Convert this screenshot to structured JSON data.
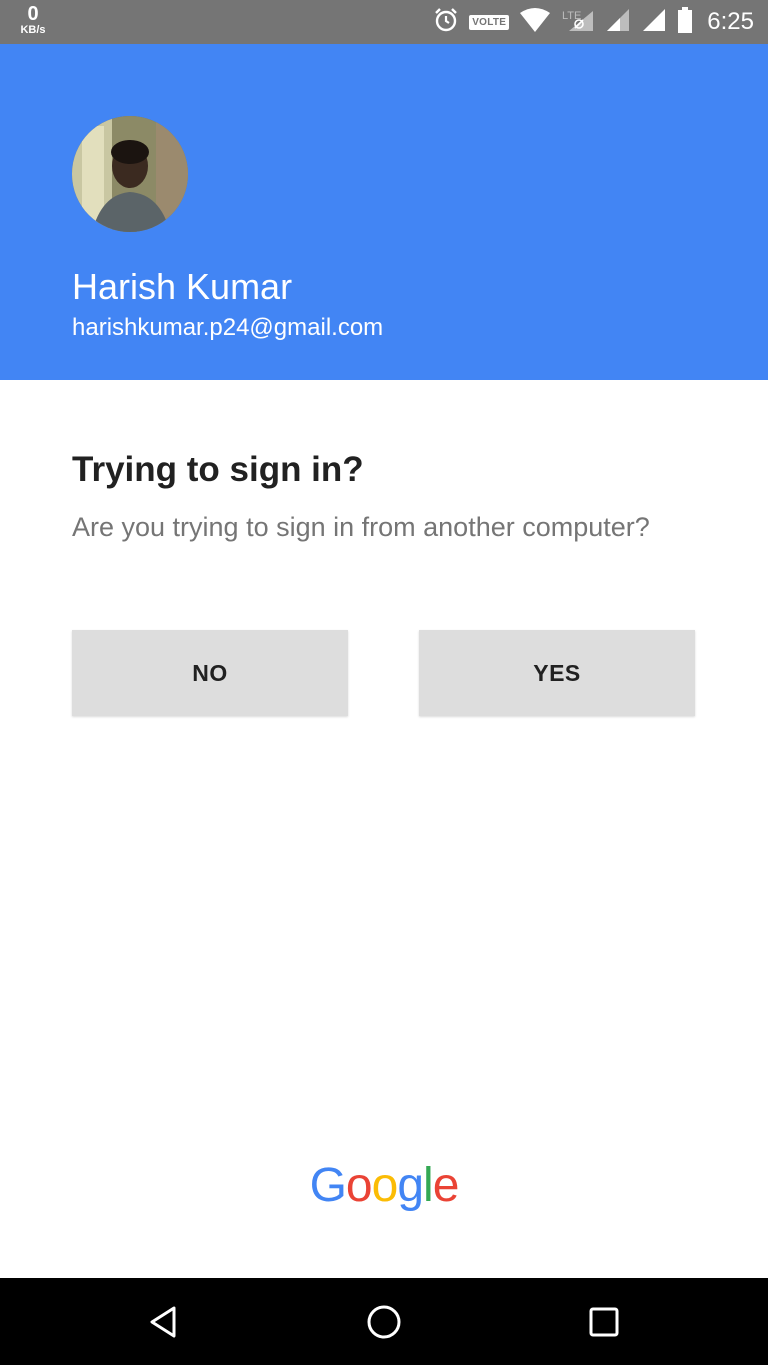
{
  "status_bar": {
    "net_speed_value": "0",
    "net_speed_unit": "KB/s",
    "volte_label": "VOLTE",
    "time": "6:25",
    "icons": [
      "alarm-icon",
      "volte-badge",
      "wifi-icon",
      "lte-icon",
      "signal-icon",
      "signal-icon",
      "battery-icon"
    ]
  },
  "header": {
    "background_color": "#4285f4",
    "user_name": "Harish Kumar",
    "user_email": "harishkumar.p24@gmail.com"
  },
  "prompt": {
    "title": "Trying to sign in?",
    "question": "Are you trying to sign in from another computer?"
  },
  "buttons": {
    "no_label": "NO",
    "yes_label": "YES"
  },
  "footer": {
    "logo_letters": [
      "G",
      "o",
      "o",
      "g",
      "l",
      "e"
    ],
    "logo_colors": [
      "#4285f4",
      "#ea4335",
      "#fbbc05",
      "#4285f4",
      "#34a853",
      "#ea4335"
    ]
  },
  "nav_bar": {
    "icons": [
      "back-icon",
      "home-icon",
      "recents-icon"
    ]
  }
}
